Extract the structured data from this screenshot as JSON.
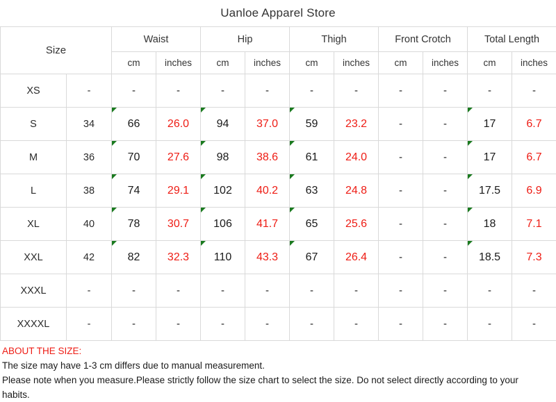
{
  "title": "Uanloe Apparel Store",
  "table": {
    "size_header": "Size",
    "groups": [
      {
        "label": "Waist"
      },
      {
        "label": "Hip"
      },
      {
        "label": "Thigh"
      },
      {
        "label": "Front Crotch"
      },
      {
        "label": "Total Length"
      }
    ],
    "unit_cm": "cm",
    "unit_inches": "inches",
    "rows": [
      {
        "size": "XS",
        "num": "-",
        "waist_cm": "-",
        "waist_in": "-",
        "hip_cm": "-",
        "hip_in": "-",
        "thigh_cm": "-",
        "thigh_in": "-",
        "crotch_cm": "-",
        "crotch_in": "-",
        "length_cm": "-",
        "length_in": "-",
        "marked": false
      },
      {
        "size": "S",
        "num": "34",
        "waist_cm": "66",
        "waist_in": "26.0",
        "hip_cm": "94",
        "hip_in": "37.0",
        "thigh_cm": "59",
        "thigh_in": "23.2",
        "crotch_cm": "-",
        "crotch_in": "-",
        "length_cm": "17",
        "length_in": "6.7",
        "marked": true
      },
      {
        "size": "M",
        "num": "36",
        "waist_cm": "70",
        "waist_in": "27.6",
        "hip_cm": "98",
        "hip_in": "38.6",
        "thigh_cm": "61",
        "thigh_in": "24.0",
        "crotch_cm": "-",
        "crotch_in": "-",
        "length_cm": "17",
        "length_in": "6.7",
        "marked": true
      },
      {
        "size": "L",
        "num": "38",
        "waist_cm": "74",
        "waist_in": "29.1",
        "hip_cm": "102",
        "hip_in": "40.2",
        "thigh_cm": "63",
        "thigh_in": "24.8",
        "crotch_cm": "-",
        "crotch_in": "-",
        "length_cm": "17.5",
        "length_in": "6.9",
        "marked": true
      },
      {
        "size": "XL",
        "num": "40",
        "waist_cm": "78",
        "waist_in": "30.7",
        "hip_cm": "106",
        "hip_in": "41.7",
        "thigh_cm": "65",
        "thigh_in": "25.6",
        "crotch_cm": "-",
        "crotch_in": "-",
        "length_cm": "18",
        "length_in": "7.1",
        "marked": true
      },
      {
        "size": "XXL",
        "num": "42",
        "waist_cm": "82",
        "waist_in": "32.3",
        "hip_cm": "110",
        "hip_in": "43.3",
        "thigh_cm": "67",
        "thigh_in": "26.4",
        "crotch_cm": "-",
        "crotch_in": "-",
        "length_cm": "18.5",
        "length_in": "7.3",
        "marked": true
      },
      {
        "size": "XXXL",
        "num": "-",
        "waist_cm": "-",
        "waist_in": "-",
        "hip_cm": "-",
        "hip_in": "-",
        "thigh_cm": "-",
        "thigh_in": "-",
        "crotch_cm": "-",
        "crotch_in": "-",
        "length_cm": "-",
        "length_in": "-",
        "marked": false
      },
      {
        "size": "XXXXL",
        "num": "-",
        "waist_cm": "-",
        "waist_in": "-",
        "hip_cm": "-",
        "hip_in": "-",
        "thigh_cm": "-",
        "thigh_in": "-",
        "crotch_cm": "-",
        "crotch_in": "-",
        "length_cm": "-",
        "length_in": "-",
        "marked": false
      }
    ]
  },
  "note": {
    "heading": "ABOUT THE SIZE:",
    "line1": "The size may have 1-3 cm differs due to manual measurement.",
    "line2": "Please note when you measure.Please strictly follow the size chart  to select the size. Do not select directly according to your",
    "line3": "habits."
  },
  "colors": {
    "header_red": "#f0564f",
    "value_red": "#ee1c14",
    "marker_green": "#1a7a1f",
    "border": "#d9d9d9",
    "text": "#2b2b2b"
  }
}
